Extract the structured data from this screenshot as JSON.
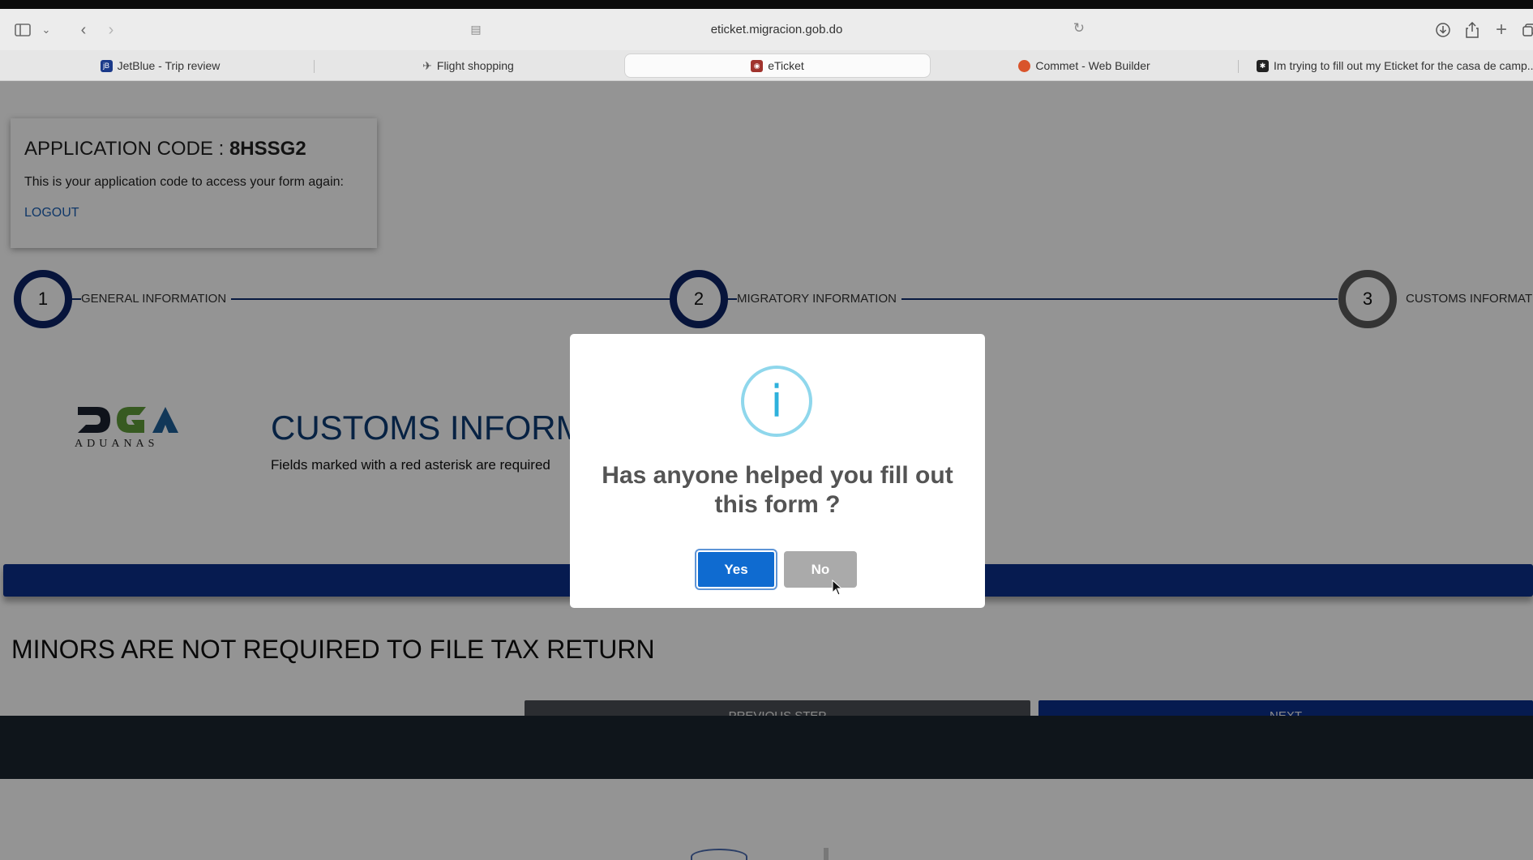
{
  "browser": {
    "url": "eticket.migracion.gob.do",
    "tabs": [
      {
        "label": "JetBlue - Trip review",
        "favicon": "jetblue-favicon",
        "color": "#1b3a8a"
      },
      {
        "label": "Flight shopping",
        "favicon": "plane-icon",
        "color": "#555555"
      },
      {
        "label": "eTicket",
        "favicon": "eticket-favicon",
        "color": "#a0332d",
        "active": true
      },
      {
        "label": "Commet - Web Builder",
        "favicon": "commet-favicon",
        "color": "#d9542b"
      },
      {
        "label": "Im trying to fill out my Eticket for the casa de camp...",
        "favicon": "chat-favicon",
        "color": "#222222"
      }
    ]
  },
  "app": {
    "code_label": "APPLICATION CODE :",
    "code_value": "8HSSG2",
    "note": "This is your application code to access your form again:",
    "logout": "LOGOUT"
  },
  "steps": [
    {
      "number": "1",
      "label": "GENERAL INFORMATION"
    },
    {
      "number": "2",
      "label": "MIGRATORY INFORMATION"
    },
    {
      "number": "3",
      "label": "CUSTOMS INFORMATION"
    }
  ],
  "section": {
    "logo_text": "ADUANAS",
    "title": "CUSTOMS INFORMATION",
    "required_note": "Fields marked with a red asterisk are required"
  },
  "minors_notice": "MINORS ARE NOT REQUIRED TO FILE TAX RETURN",
  "nav": {
    "previous": "PREVIOUS STEP",
    "next": "NEXT"
  },
  "modal": {
    "icon": "i",
    "title": "Has anyone helped you fill out this form ?",
    "yes": "Yes",
    "no": "No"
  },
  "colors": {
    "accent": "#0b2f8a",
    "step_ring": "#0d2466",
    "yes_button": "#0f6bd0",
    "info_icon": "#2eb1dc"
  }
}
